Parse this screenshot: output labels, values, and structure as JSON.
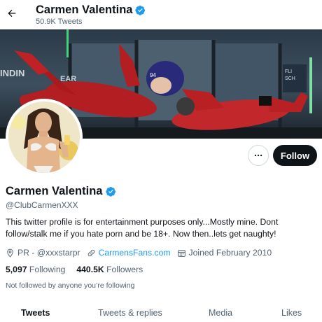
{
  "header": {
    "name": "Carmen Valentina",
    "tweet_count": "50.9K Tweets"
  },
  "profile": {
    "display_name": "Carmen Valentina",
    "handle": "@ClubCarmenXXX",
    "bio": "This twitter profile is for entertainment purposes only...Mostly mine. Dont follow/stalk me if you hate porn and be 18+. Now then..lets get naughty!",
    "location": "PR - @xxxstarpr",
    "website": "CarmensFans.com",
    "joined": "Joined February 2010",
    "following_count": "5,097",
    "following_label": "Following",
    "followers_count": "440.5K",
    "followers_label": "Followers",
    "followed_by_note": "Not followed by anyone you’re following"
  },
  "actions": {
    "follow_label": "Follow"
  },
  "tabs": [
    {
      "label": "Tweets",
      "active": true
    },
    {
      "label": "Tweets & replies",
      "active": false
    },
    {
      "label": "Media",
      "active": false
    },
    {
      "label": "Likes",
      "active": false
    }
  ],
  "colors": {
    "accent": "#1d9bf0",
    "follow_bg": "#0f1419",
    "secondary_text": "#536471"
  },
  "icons": {
    "back": "arrow-left-icon",
    "verified": "verified-badge-icon",
    "more": "more-horizontal-icon",
    "location": "location-pin-icon",
    "link": "link-icon",
    "calendar": "calendar-icon"
  }
}
